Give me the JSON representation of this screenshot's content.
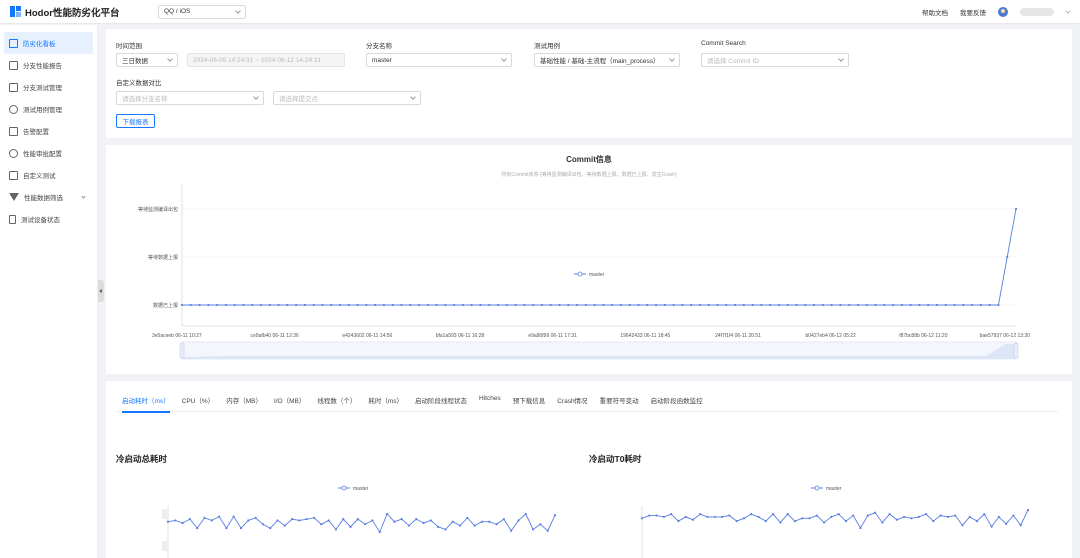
{
  "header": {
    "title": "Hodor性能防劣化平台",
    "app_select": "QQ / iOS",
    "help": "帮助文档",
    "feedback": "我要反馈"
  },
  "sidebar": {
    "items": [
      {
        "label": "防劣化看板",
        "icon": "line-chart-icon"
      },
      {
        "label": "分支性能报告",
        "icon": "list-icon"
      },
      {
        "label": "分支测试管理",
        "icon": "grid-icon"
      },
      {
        "label": "测试用例管理",
        "icon": "gear-icon"
      },
      {
        "label": "告警配置",
        "icon": "bell-icon"
      },
      {
        "label": "性能审批配置",
        "icon": "clock-icon"
      },
      {
        "label": "自定义测试",
        "icon": "terminal-icon"
      },
      {
        "label": "性能数据筛选",
        "icon": "filter-icon"
      },
      {
        "label": "测试设备状态",
        "icon": "phone-icon"
      }
    ]
  },
  "filters": {
    "time_label": "时间范围",
    "time_select": "三日数据",
    "time_range": "2024-06-09 14:24:31 ~ 2024-06-12 14:24:31",
    "branch_label": "分支名称",
    "branch_value": "master",
    "case_label": "测试用例",
    "case_value": "基础性能 / 基础-主流程（main_process）",
    "commit_label": "Commit Search",
    "commit_placeholder": "请选择 Commit ID",
    "custom_label": "自定义数据对比",
    "custom_branch_placeholder": "请选择分支名称",
    "custom_commit_placeholder": "请选择提交点",
    "download": "下载报表"
  },
  "commit_chart": {
    "title": "Commit信息",
    "subtitle": "所有Commit状态 (等待监测编译出包、等待数据上报、数据已上报、发生Crash)",
    "legend": "master",
    "y_labels": [
      "等待监测编译出包",
      "等待数据上报",
      "数据已上报"
    ],
    "x_labels": [
      "3e5aceeb 06-11 10:27",
      "ce9afb40 06-11 12:36",
      "e4243602 06-11 14:56",
      "bfa1a593 06-11 16:28",
      "e9a80f99 06-11 17:31",
      "19642433 06-11 18:45",
      "24f7f1f4 06-11 20:51",
      "b0427eb4 06-12 05:22",
      "f87bc88b 06-12 11:20",
      "bae57937 06-12 13:30"
    ]
  },
  "chart_data": [
    {
      "type": "line",
      "title": "Commit信息",
      "y_categories": [
        "数据已上报",
        "等待数据上报",
        "等待监测编译出包"
      ],
      "series": [
        {
          "name": "master",
          "values": [
            0,
            0,
            0,
            0,
            0,
            0,
            0,
            0,
            0,
            0,
            0,
            0,
            0,
            0,
            0,
            0,
            0,
            0,
            0,
            0,
            0,
            0,
            0,
            0,
            0,
            0,
            0,
            0,
            0,
            0,
            0,
            0,
            0,
            0,
            0,
            0,
            0,
            0,
            0,
            0,
            0,
            0,
            0,
            0,
            0,
            0,
            0,
            0,
            0,
            0,
            0,
            0,
            0,
            0,
            0,
            0,
            0,
            0,
            0,
            0,
            0,
            0,
            0,
            0,
            0,
            0,
            0,
            0,
            0,
            0,
            0,
            0,
            0,
            0,
            0,
            0,
            0,
            0,
            0,
            0,
            0,
            0,
            0,
            0,
            0,
            0,
            0,
            0,
            0,
            0,
            0,
            0,
            0,
            0,
            1,
            2
          ]
        }
      ]
    },
    {
      "type": "line",
      "title": "冷启动总耗时",
      "series": [
        {
          "name": "master",
          "values": [
            524,
            525,
            523,
            526,
            519,
            527,
            525,
            528,
            519,
            528,
            519,
            525,
            527,
            522,
            519,
            525,
            521,
            526,
            525,
            526,
            527,
            522,
            525,
            518,
            526,
            520,
            526,
            522,
            525,
            516,
            530,
            524,
            526,
            521,
            526,
            523,
            525,
            520,
            518,
            524,
            521,
            527,
            521,
            524,
            524,
            522,
            526,
            517,
            525,
            530,
            518,
            522,
            517,
            529
          ]
        }
      ]
    },
    {
      "type": "line",
      "title": "冷启动T0耗时",
      "series": [
        {
          "name": "master",
          "values": [
            523,
            525,
            525,
            524,
            526,
            521,
            524,
            522,
            526,
            524,
            524,
            524,
            525,
            521,
            523,
            526,
            524,
            521,
            526,
            520,
            526,
            521,
            523,
            523,
            525,
            520,
            524,
            526,
            521,
            525,
            516,
            525,
            527,
            520,
            526,
            522,
            524,
            523,
            524,
            526,
            521,
            525,
            524,
            525,
            518,
            524,
            521,
            526,
            517,
            524,
            519,
            525,
            518,
            529
          ]
        }
      ]
    }
  ],
  "tabs": [
    "启动耗时（ms）",
    "CPU（%）",
    "内存（MB）",
    "I/O（MB）",
    "线程数（个）",
    "耗时（ms）",
    "启动阶段线程状态",
    "Hitches",
    "预下载信息",
    "Crash情况",
    "重要符号变动",
    "启动阶段函数监控"
  ],
  "sub_charts": {
    "left_title": "冷启动总耗时",
    "right_title": "冷启动T0耗时",
    "legend": "master"
  },
  "colors": {
    "accent": "#1677ff",
    "series": "#5b7fe0"
  }
}
